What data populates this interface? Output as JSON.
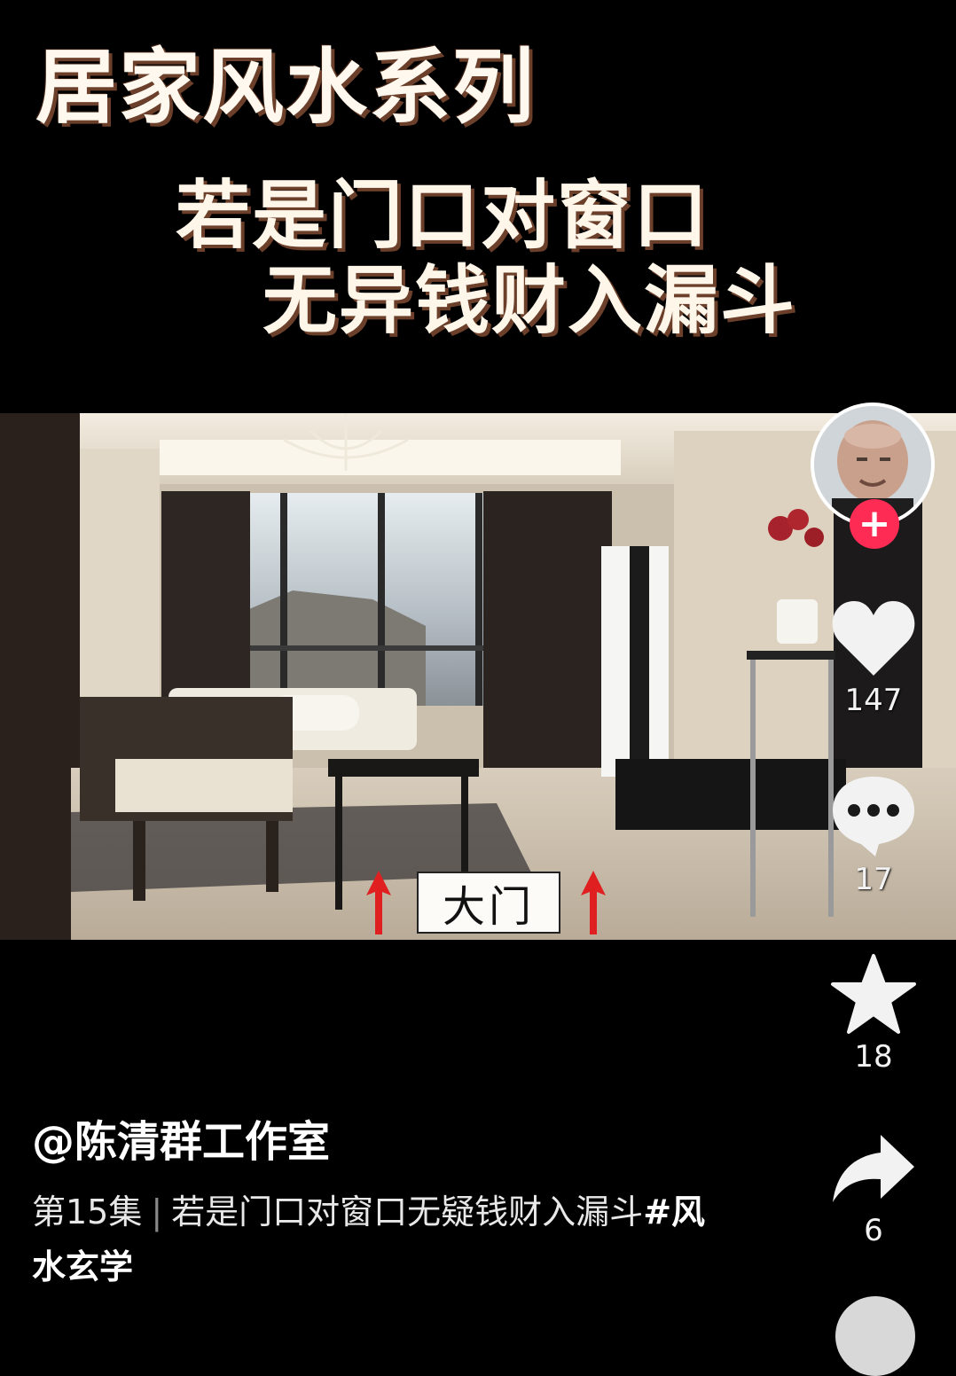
{
  "overlay": {
    "series_title": "居家风水系列",
    "headline_line1": "若是门口对窗口",
    "headline_line2": "无异钱财入漏斗",
    "door_label": "大门"
  },
  "rail": {
    "likes": "147",
    "comments": "17",
    "favorites": "18",
    "shares": "6",
    "follow_symbol": "+"
  },
  "post": {
    "author": "@陈清群工作室",
    "episode": "第15集",
    "separator": "|",
    "caption_text": "若是门口对窗口无疑钱财入漏斗",
    "hashtag": "#风水玄学"
  },
  "icons": [
    "heart-icon",
    "comment-icon",
    "star-icon",
    "share-icon",
    "arrow-up-icon"
  ],
  "colors": {
    "follow_red": "#fe2c55",
    "arrow_red": "#e02020",
    "title_shadow": "#6b3f2a"
  }
}
